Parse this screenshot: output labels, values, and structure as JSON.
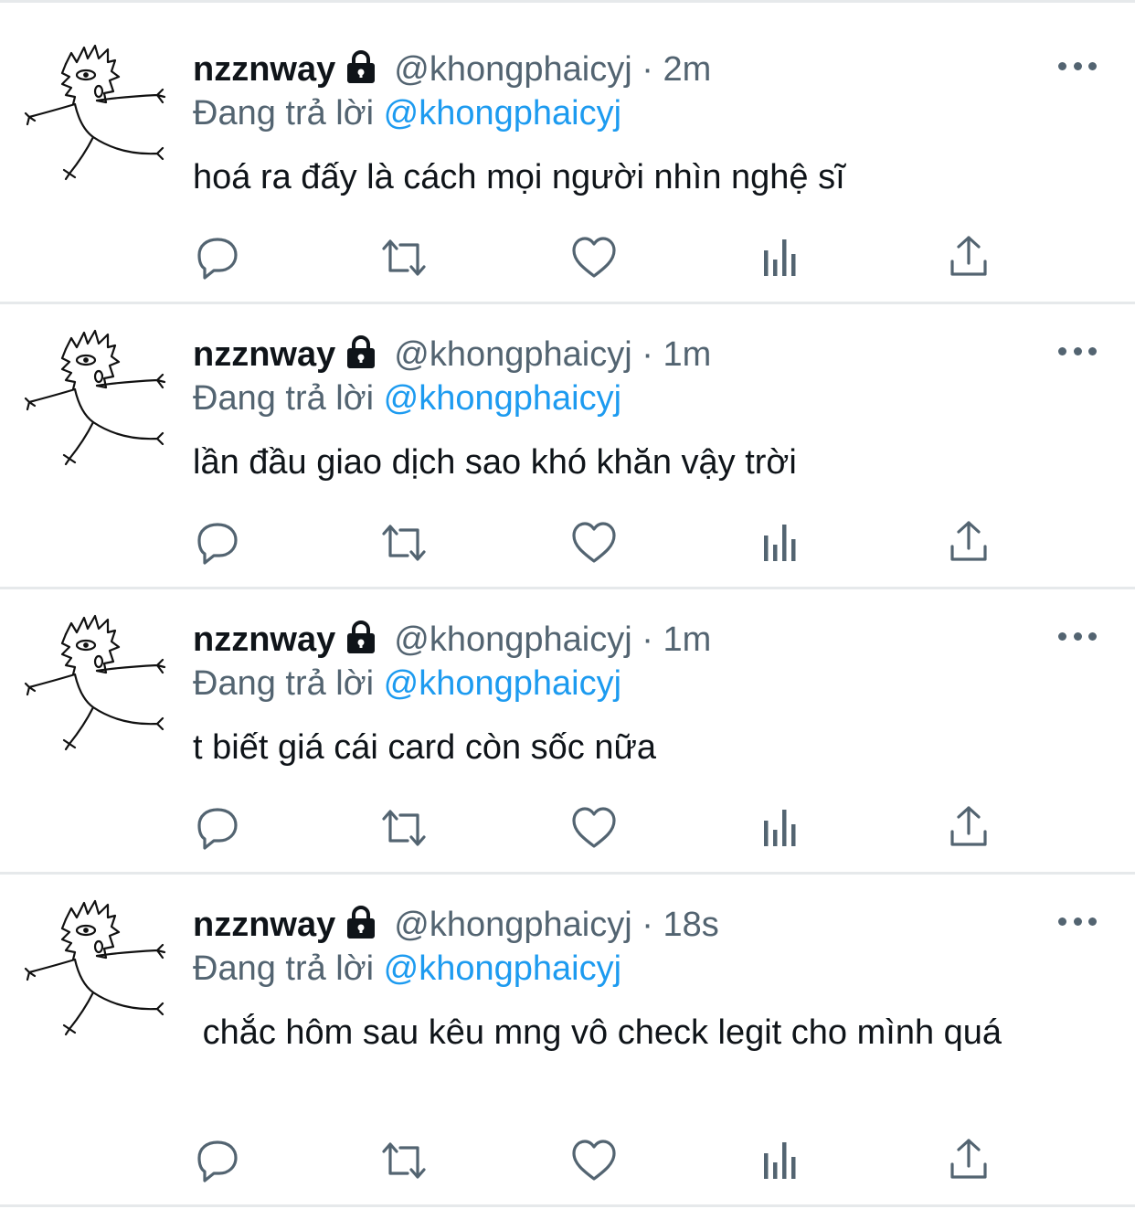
{
  "tweets": [
    {
      "name": "nzznway",
      "handle": "@khongphaicyj",
      "dot": "·",
      "time": "2m",
      "reply_prefix": "Đang trả lời",
      "reply_to": "@khongphaicyj",
      "text": "hoá ra đấy là cách mọi người nhìn nghệ sĩ"
    },
    {
      "name": "nzznway",
      "handle": "@khongphaicyj",
      "dot": "·",
      "time": "1m",
      "reply_prefix": "Đang trả lời",
      "reply_to": "@khongphaicyj",
      "text": "lần đầu giao dịch sao khó khăn vậy trời"
    },
    {
      "name": "nzznway",
      "handle": "@khongphaicyj",
      "dot": "·",
      "time": "1m",
      "reply_prefix": "Đang trả lời",
      "reply_to": "@khongphaicyj",
      "text": "t biết giá cái card còn sốc nữa"
    },
    {
      "name": "nzznway",
      "handle": "@khongphaicyj",
      "dot": "·",
      "time": "18s",
      "reply_prefix": "Đang trả lời",
      "reply_to": "@khongphaicyj",
      "text": " chắc hôm sau kêu mng vô check legit cho mình quá"
    }
  ],
  "icons": {
    "lock": "lock-icon",
    "more": "more-icon",
    "reply": "reply-icon",
    "retweet": "retweet-icon",
    "like": "heart-icon",
    "views": "analytics-icon",
    "share": "share-icon",
    "avatar": "avatar-doodle"
  },
  "colors": {
    "text": "#0f1419",
    "secondary": "#536471",
    "link": "#1d9bf0",
    "divider": "#e6e9eb"
  }
}
